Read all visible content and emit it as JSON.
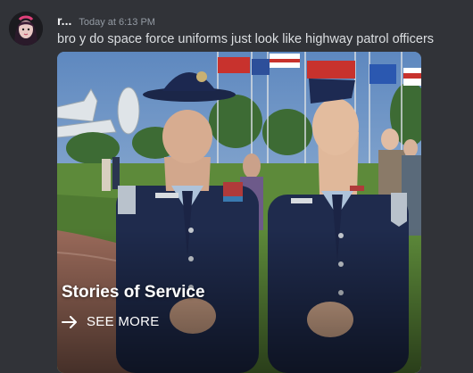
{
  "message": {
    "username": "r...",
    "timestamp": "Today at 6:13 PM",
    "text": "bro y do space force uniforms just look like highway patrol officers"
  },
  "embed": {
    "title": "Stories of Service",
    "link_label": "SEE MORE",
    "link_icon": "arrow-right-icon"
  },
  "colors": {
    "background": "#313338",
    "username": "#f2f3f5",
    "timestamp": "#949ba4",
    "message_text": "#dbdee1"
  }
}
